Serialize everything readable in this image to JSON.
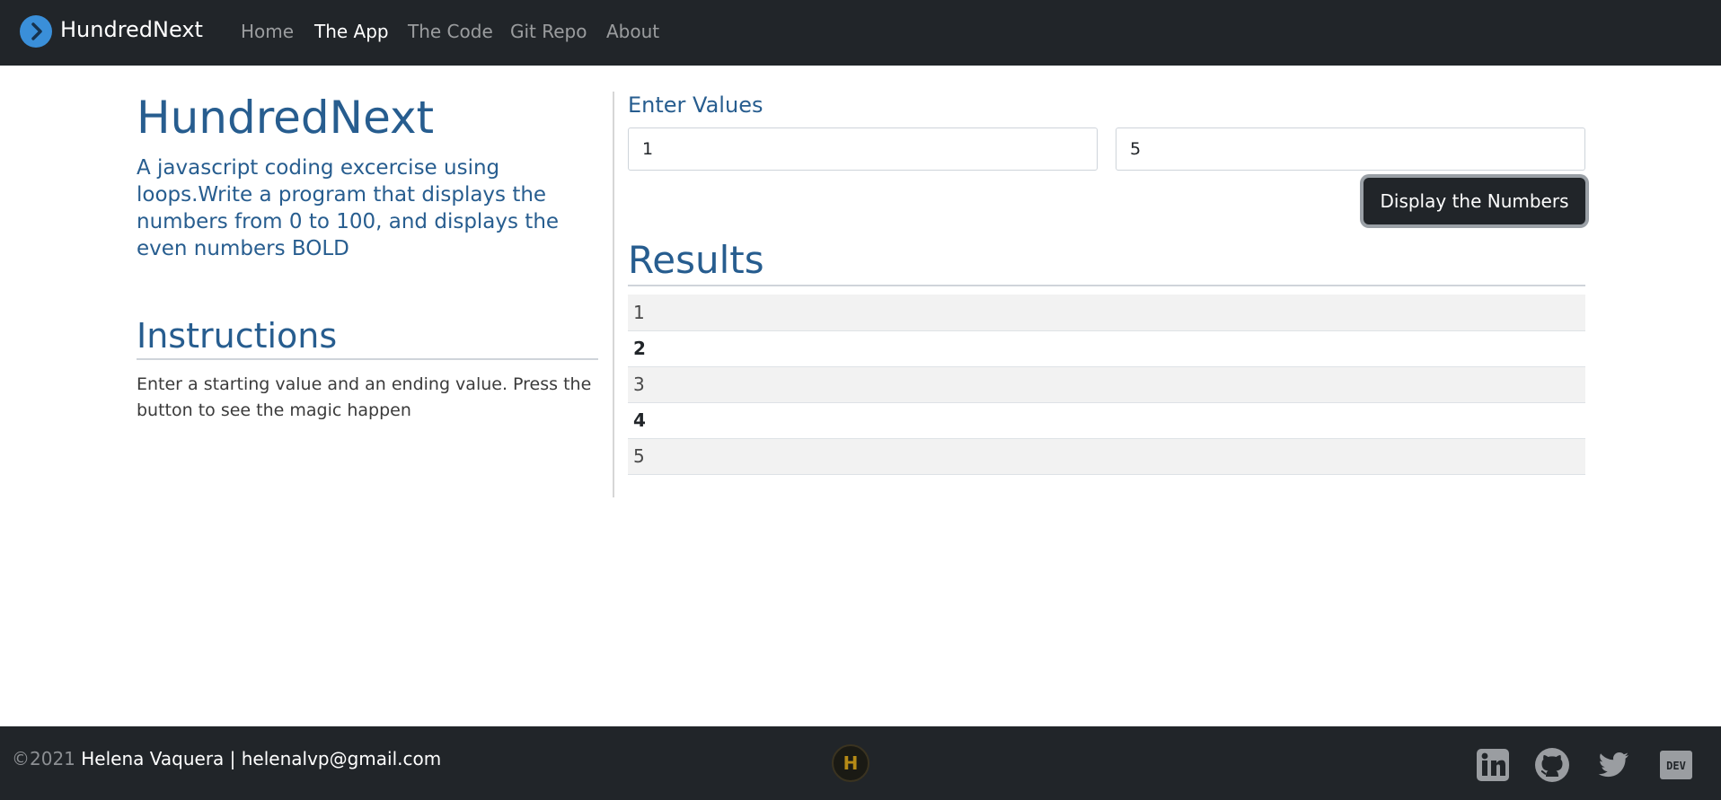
{
  "navbar": {
    "brand": "HundredNext",
    "links": [
      {
        "label": "Home",
        "active": false
      },
      {
        "label": "The App",
        "active": true
      },
      {
        "label": "The Code",
        "active": false
      },
      {
        "label": "Git Repo",
        "active": false
      },
      {
        "label": "About",
        "active": false
      }
    ]
  },
  "intro": {
    "title": "HundredNext",
    "description": "A javascript coding excercise using loops.Write a program that displays the numbers from 0 to 100, and displays the even numbers BOLD"
  },
  "instructions": {
    "heading": "Instructions",
    "text": "Enter a starting value and an ending value. Press the button to see the magic happen"
  },
  "form": {
    "label": "Enter Values",
    "start_value": "1",
    "end_value": "5",
    "button_label": "Display the Numbers"
  },
  "results": {
    "heading": "Results",
    "rows": [
      "1",
      "2",
      "3",
      "4",
      "5"
    ]
  },
  "footer": {
    "copyright": "©2021",
    "author": " Helena Vaquera | helenalvp@gmail.com",
    "logo_letter": "H",
    "social_icons": [
      "linkedin-icon",
      "github-icon",
      "twitter-icon",
      "dev-icon"
    ]
  },
  "colors": {
    "navbar_bg": "#212529",
    "heading_blue": "#275d8f",
    "brand_logo": "#3a8fd9",
    "social_icon": "#9a9da1"
  }
}
